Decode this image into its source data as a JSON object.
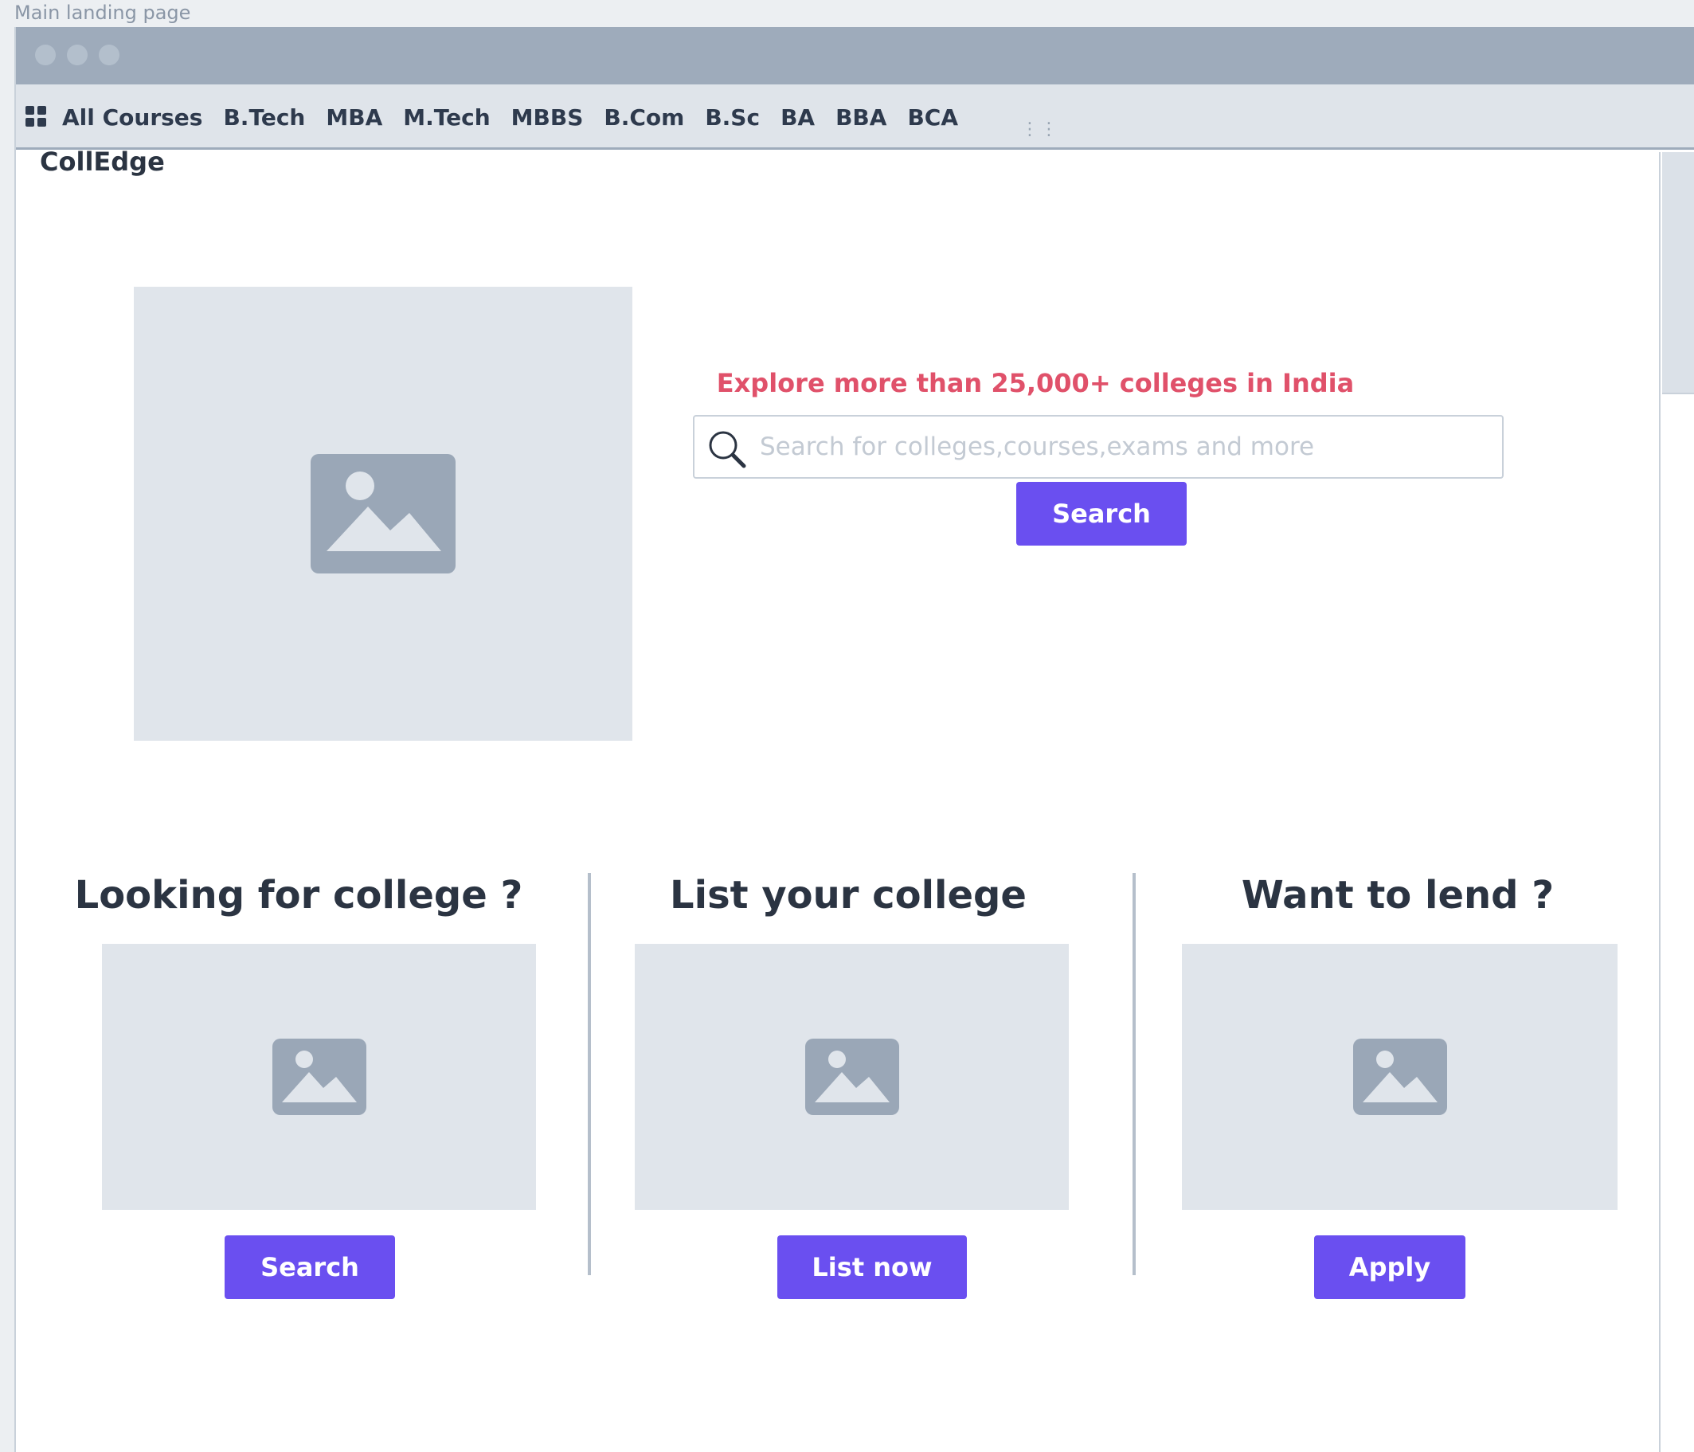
{
  "page_label": "Main landing page",
  "nav": {
    "items": [
      "All Courses",
      "B.Tech",
      "MBA",
      "M.Tech",
      "MBBS",
      "B.Com",
      "B.Sc",
      "BA",
      "BBA",
      "BCA"
    ],
    "more_label": "⋮⋮"
  },
  "brand": "CollEdge",
  "hero": {
    "tagline": "Explore more than 25,000+ colleges in India",
    "search_placeholder": "Search for colleges,courses,exams and more",
    "search_button": "Search"
  },
  "columns": [
    {
      "title": "Looking for college ?",
      "button": "Search"
    },
    {
      "title": "List your college",
      "button": "List now"
    },
    {
      "title": "Want to lend ?",
      "button": "Apply"
    }
  ],
  "colors": {
    "accent": "#6a4ff0",
    "tagline": "#e0516a",
    "titlebar": "#9eabbb",
    "placeholder_bg": "#e0e5eb"
  }
}
